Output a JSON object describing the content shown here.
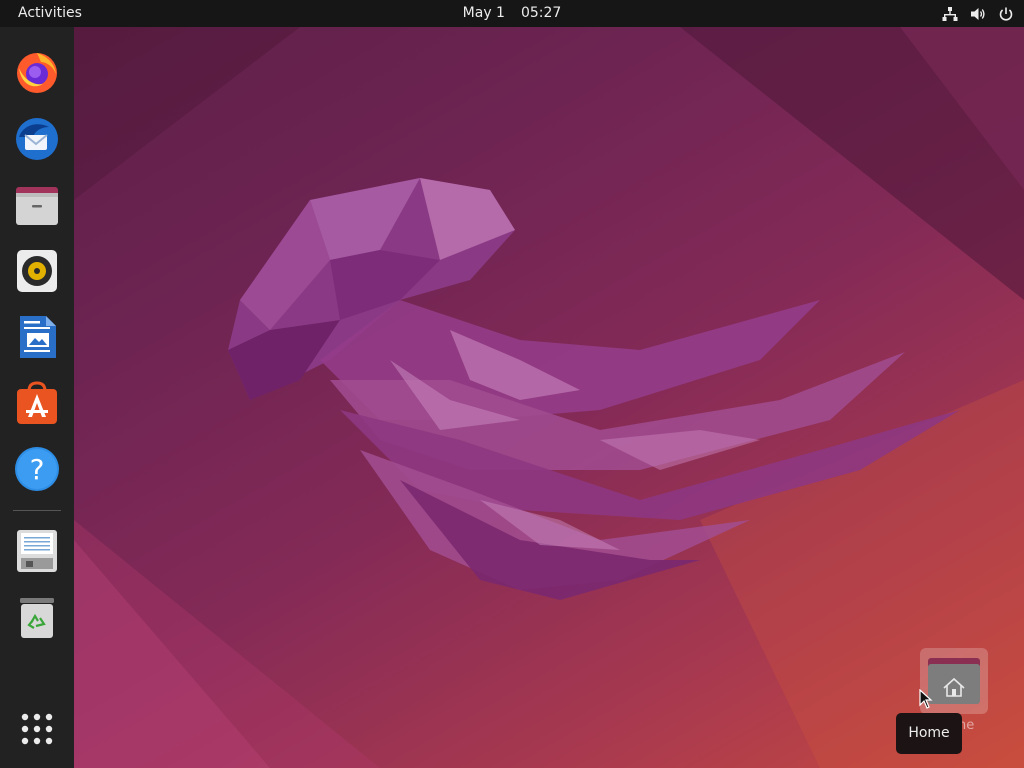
{
  "topbar": {
    "activities_label": "Activities",
    "date": "May 1",
    "time": "05:27",
    "icons": [
      "network-icon",
      "volume-icon",
      "power-icon"
    ]
  },
  "dock": {
    "items": [
      {
        "name": "firefox",
        "icon": "firefox-icon"
      },
      {
        "name": "thunderbird",
        "icon": "thunderbird-mail-icon"
      },
      {
        "name": "files",
        "icon": "files-icon"
      },
      {
        "name": "rhythmbox",
        "icon": "rhythmbox-icon"
      },
      {
        "name": "libreoffice-writer",
        "icon": "writer-document-icon"
      },
      {
        "name": "ubuntu-software",
        "icon": "software-store-icon"
      },
      {
        "name": "help",
        "icon": "help-icon"
      },
      {
        "name": "save-drive",
        "icon": "floppy-drive-icon"
      },
      {
        "name": "trash",
        "icon": "trash-icon"
      },
      {
        "name": "show-applications",
        "icon": "app-grid-icon"
      }
    ]
  },
  "desktop": {
    "home_icon_label": "Home"
  },
  "tooltip": {
    "text": "Home"
  },
  "colors": {
    "topbar": "#161616",
    "dock": "#222222",
    "wallpaper_dark": "#5b1f45",
    "wallpaper_light": "#c64a3f",
    "jellyfish": "#9b3f8f"
  }
}
